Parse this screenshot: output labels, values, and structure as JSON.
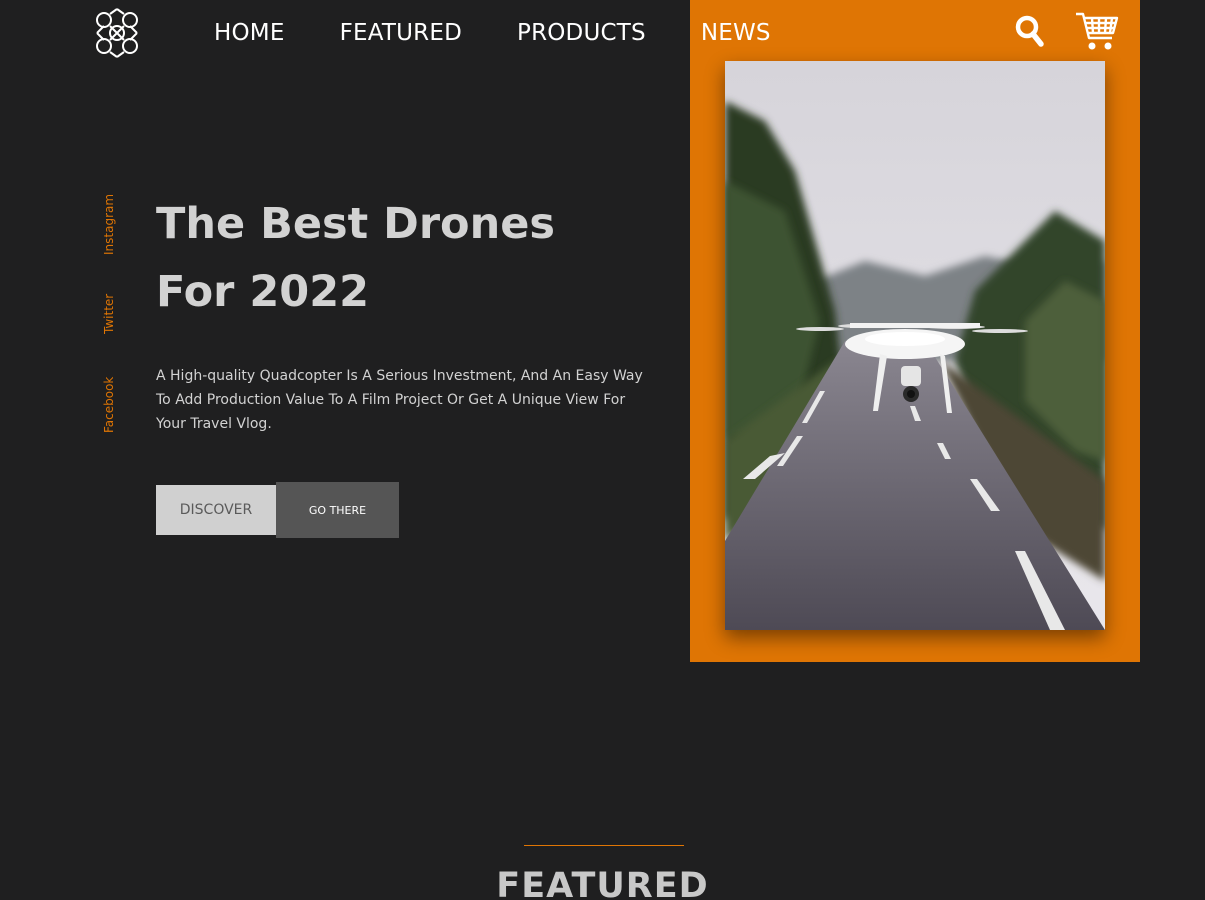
{
  "header": {
    "logo_icon": "drone-logo-icon",
    "nav": [
      {
        "label": "HOME"
      },
      {
        "label": "FEATURED"
      },
      {
        "label": "PRODUCTS"
      },
      {
        "label": "NEWS"
      }
    ],
    "search_icon": "search-icon",
    "cart_icon": "shopping-cart-icon"
  },
  "social": {
    "instagram": "Instagram",
    "twitter": "Twitter",
    "facebook": "Facebook"
  },
  "hero": {
    "title_line1": "The Best Drones",
    "title_line2": "For 2022",
    "description": "A High-quality Quadcopter Is A Serious Investment, And An Easy Way To Add Production Value To A Film Project Or Get A Unique View For Your Travel Vlog.",
    "discover_label": "DISCOVER",
    "go_label": "GO THERE",
    "image_subject": "white quadcopter drone hovering over a rural road"
  },
  "featured": {
    "title": "FEATURED"
  },
  "colors": {
    "background": "#1f1f20",
    "accent": "#df7504",
    "text": "#d2d2d2"
  }
}
